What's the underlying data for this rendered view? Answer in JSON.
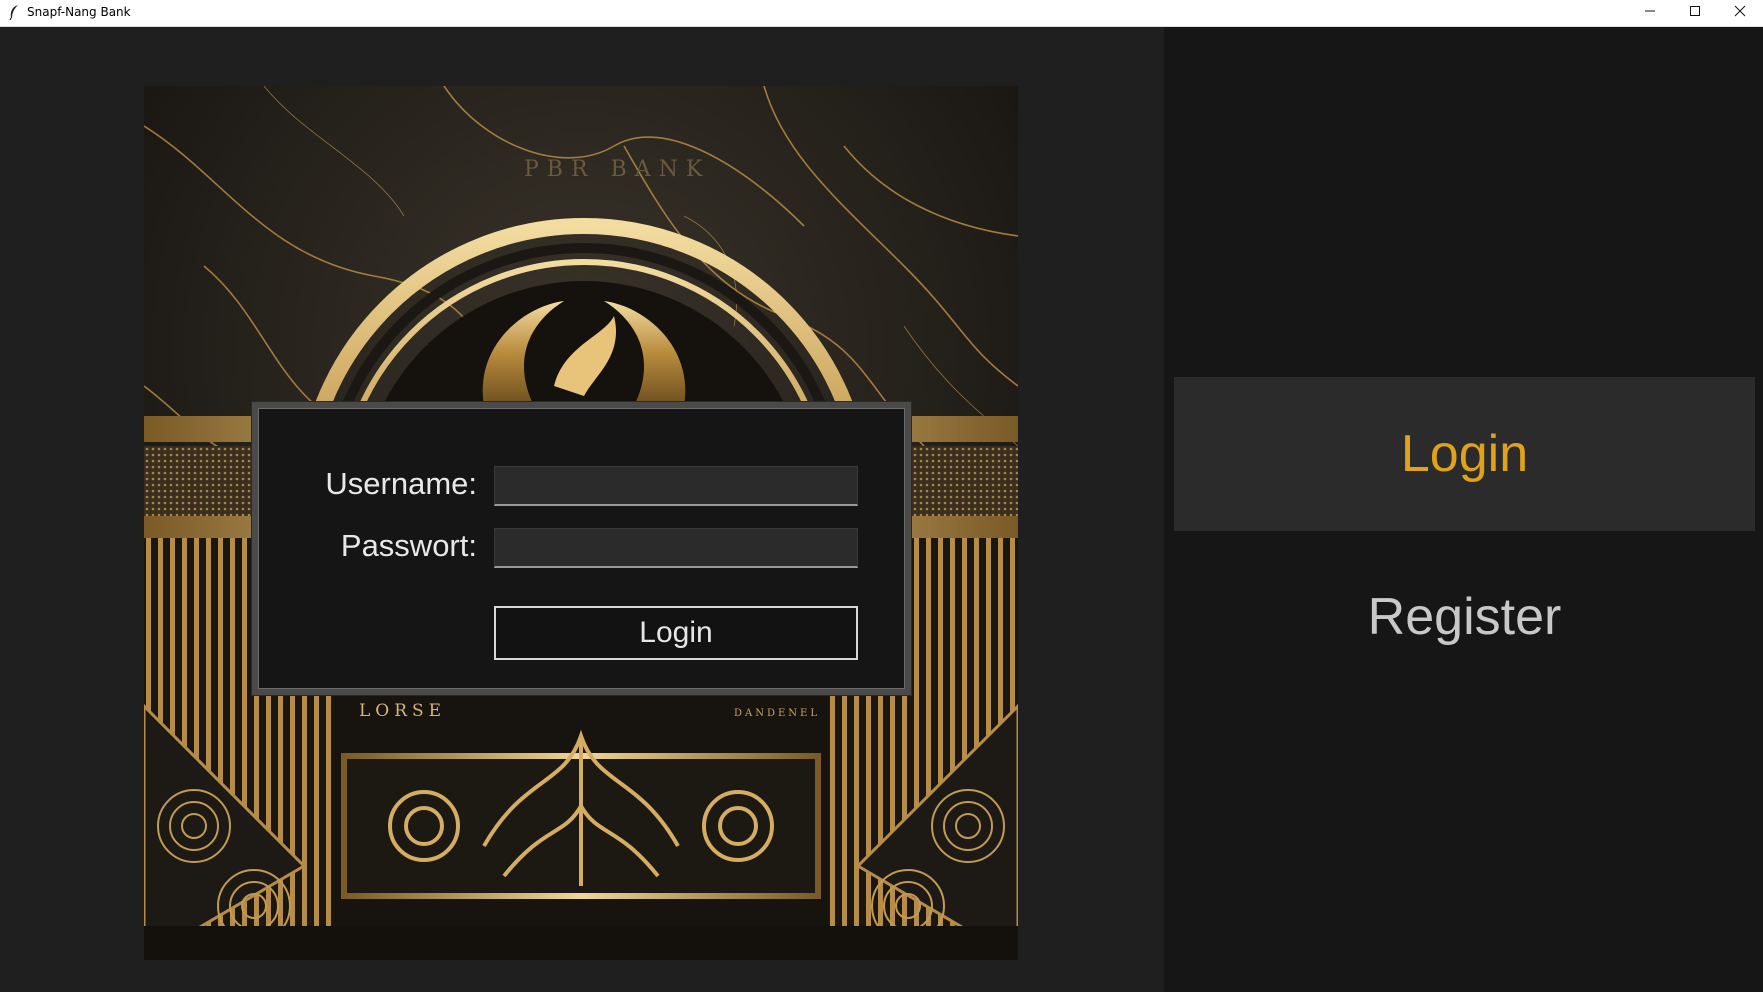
{
  "window": {
    "title": "Snapf-Nang Bank",
    "icon": "feather-icon",
    "controls": [
      "minimize-icon",
      "maximize-icon",
      "close-icon"
    ]
  },
  "login_form": {
    "username_label": "Username:",
    "username_value": "",
    "password_label": "Passwort:",
    "password_value": "",
    "submit_label": "Login"
  },
  "image_text": {
    "top_engraving": "PBR BANK",
    "left_engraving": "LORSE",
    "right_engraving": "DANDENEL"
  },
  "side_nav": {
    "items": [
      {
        "label": "Login",
        "active": true
      },
      {
        "label": "Register",
        "active": false
      }
    ]
  },
  "colors": {
    "accent_gold": "#e0a21b",
    "background": "#1f1f1f",
    "side_panel": "#161616",
    "active_tab": "#2b2b2b"
  }
}
